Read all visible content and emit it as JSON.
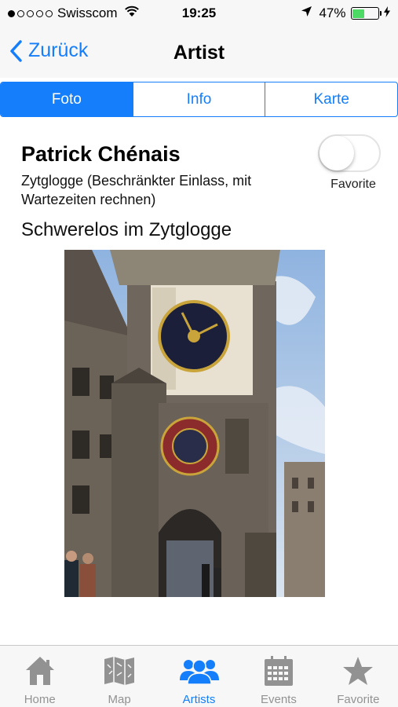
{
  "status_bar": {
    "carrier": "Swisscom",
    "time": "19:25",
    "battery": "47%",
    "battery_level": 0.47,
    "signal_bars": 1,
    "battery_color": "#4cd964"
  },
  "nav": {
    "back_label": "Zurück",
    "title": "Artist"
  },
  "segments": [
    {
      "label": "Foto",
      "active": true
    },
    {
      "label": "Info",
      "active": false
    },
    {
      "label": "Karte",
      "active": false
    }
  ],
  "artist": {
    "name": "Patrick Chénais",
    "location": "Zytglogge (Beschränkter Einlass, mit Wartezeiten rechnen)",
    "favorite_label": "Favorite",
    "favorite_on": false,
    "event_title": "Schwerelos im Zytglogge"
  },
  "tabs": [
    {
      "label": "Home",
      "icon": "home-icon",
      "active": false
    },
    {
      "label": "Map",
      "icon": "map-icon",
      "active": false
    },
    {
      "label": "Artists",
      "icon": "artists-icon",
      "active": true
    },
    {
      "label": "Events",
      "icon": "calendar-icon",
      "active": false
    },
    {
      "label": "Favorite",
      "icon": "star-icon",
      "active": false
    }
  ],
  "colors": {
    "accent": "#157efb",
    "inactive": "#929292",
    "bar_background": "#f7f7f7"
  }
}
